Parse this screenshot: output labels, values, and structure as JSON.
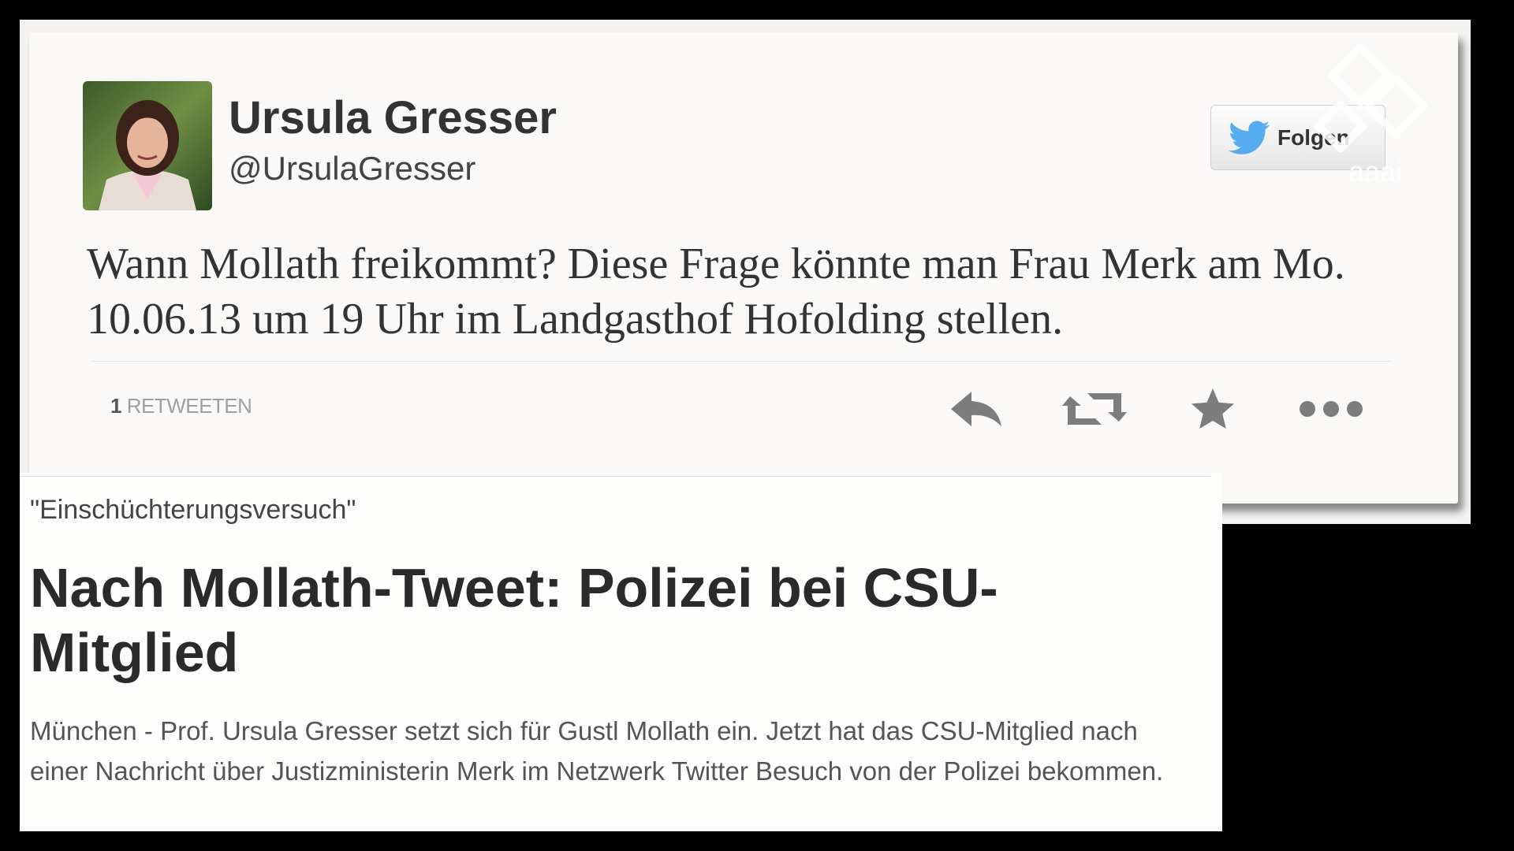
{
  "tweet": {
    "author_name": "Ursula Gresser",
    "author_handle": "@UrsulaGresser",
    "follow_label": "Folgen",
    "text": "Wann Mollath freikommt? Diese Frage könnte man Frau Merk am Mo. 10.06.13 um 19 Uhr im Landgasthof Hofolding stellen.",
    "retweet_count": "1",
    "retweet_label": "RETWEETEN",
    "actions": [
      {
        "name": "reply-icon"
      },
      {
        "name": "retweet-icon"
      },
      {
        "name": "favorite-icon"
      },
      {
        "name": "more-icon"
      }
    ],
    "brand_color": "#55acee"
  },
  "article": {
    "kicker": "\"Einschüchterungsversuch\"",
    "headline": "Nach Mollath-Tweet: Polizei bei CSU-Mitglied",
    "teaser": "München - Prof. Ursula Gresser setzt sich für Gustl Mollath ein. Jetzt hat das CSU-Mitglied nach einer Nachricht über Justizministerin Merk im Netzwerk Twitter Besuch von der Polizei bekommen."
  }
}
